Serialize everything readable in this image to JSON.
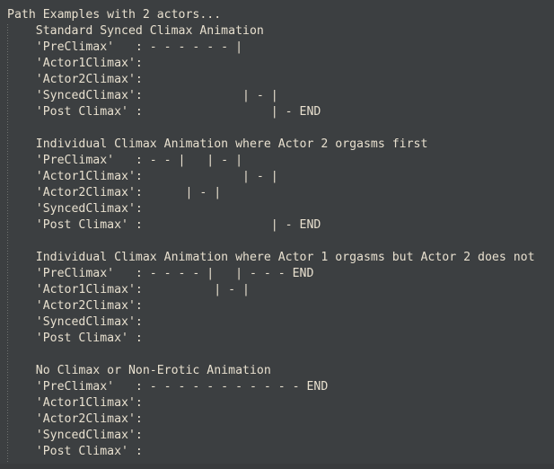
{
  "console": {
    "background_color": "#3c3f41",
    "text_color": "#e8e0cf",
    "indent_guide_color": "#6f7270",
    "title": "Path Examples with 2 actors...",
    "labels": {
      "pre_climax": "'PreClimax'",
      "actor1_climax": "'Actor1Climax'",
      "actor2_climax": "'Actor2Climax'",
      "synced_climax": "'SyncedClimax'",
      "post_climax": "'Post Climax'"
    },
    "end_marker": "END",
    "blocks": [
      {
        "heading": "Standard Synced Climax Animation",
        "rows": [
          {
            "label": "'PreClimax'",
            "track": "- - - - - - |"
          },
          {
            "label": "'Actor1Climax'",
            "track": ""
          },
          {
            "label": "'Actor2Climax'",
            "track": ""
          },
          {
            "label": "'SyncedClimax'",
            "track": "              | - |"
          },
          {
            "label": "'Post Climax'",
            "track": "                  | - END"
          }
        ]
      },
      {
        "heading": "Individual Climax Animation where Actor 2 orgasms first",
        "rows": [
          {
            "label": "'PreClimax'",
            "track": "- - |   | - |"
          },
          {
            "label": "'Actor1Climax'",
            "track": "              | - |"
          },
          {
            "label": "'Actor2Climax'",
            "track": "      | - |"
          },
          {
            "label": "'SyncedClimax'",
            "track": ""
          },
          {
            "label": "'Post Climax'",
            "track": "                  | - END"
          }
        ]
      },
      {
        "heading": "Individual Climax Animation where Actor 1 orgasms but Actor 2 does not",
        "rows": [
          {
            "label": "'PreClimax'",
            "track": "- - - - |   | - - - END"
          },
          {
            "label": "'Actor1Climax'",
            "track": "          | - |"
          },
          {
            "label": "'Actor2Climax'",
            "track": ""
          },
          {
            "label": "'SyncedClimax'",
            "track": ""
          },
          {
            "label": "'Post Climax'",
            "track": ""
          }
        ]
      },
      {
        "heading": "No Climax or Non-Erotic Animation",
        "rows": [
          {
            "label": "'PreClimax'",
            "track": "- - - - - - - - - - - END"
          },
          {
            "label": "'Actor1Climax'",
            "track": ""
          },
          {
            "label": "'Actor2Climax'",
            "track": ""
          },
          {
            "label": "'SyncedClimax'",
            "track": ""
          },
          {
            "label": "'Post Climax'",
            "track": ""
          }
        ]
      }
    ],
    "rendered_lines": [
      "Path Examples with 2 actors...",
      "    Standard Synced Climax Animation",
      "    'PreClimax'   : - - - - - - |",
      "    'Actor1Climax':",
      "    'Actor2Climax':",
      "    'SyncedClimax':              | - |",
      "    'Post Climax' :                  | - END",
      "",
      "    Individual Climax Animation where Actor 2 orgasms first",
      "    'PreClimax'   : - - |   | - |",
      "    'Actor1Climax':              | - |",
      "    'Actor2Climax':      | - |",
      "    'SyncedClimax':",
      "    'Post Climax' :                  | - END",
      "",
      "    Individual Climax Animation where Actor 1 orgasms but Actor 2 does not",
      "    'PreClimax'   : - - - - |   | - - - END",
      "    'Actor1Climax':          | - |",
      "    'Actor2Climax':",
      "    'SyncedClimax':",
      "    'Post Climax' :",
      "",
      "    No Climax or Non-Erotic Animation",
      "    'PreClimax'   : - - - - - - - - - - - END",
      "    'Actor1Climax':",
      "    'Actor2Climax':",
      "    'SyncedClimax':",
      "    'Post Climax' :"
    ]
  }
}
